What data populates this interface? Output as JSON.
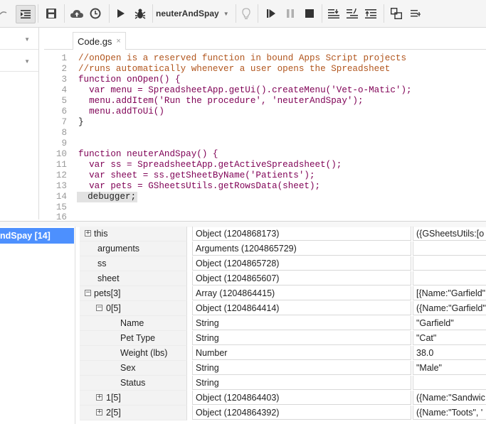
{
  "toolbar": {
    "function_name": "neuterAndSpay",
    "icons": [
      "redo-icon",
      "indent-icon",
      "save-icon",
      "publish-icon",
      "triggers-icon",
      "run-icon",
      "debug-icon",
      "hint-icon",
      "continue-icon",
      "pause-icon",
      "stop-icon",
      "step-into-icon",
      "step-over-icon",
      "step-out-icon",
      "toggle-panel-icon",
      "add-watch-icon"
    ]
  },
  "tab": {
    "label": "Code.gs",
    "close": "×"
  },
  "editor": {
    "lines": [
      {
        "num": "1",
        "text": "//onOpen is a reserved function in bound Apps Script projects"
      },
      {
        "num": "2",
        "text": "//runs automatically whenever a user opens the Spreadsheet"
      },
      {
        "num": "3",
        "text": "function onOpen() {"
      },
      {
        "num": "4",
        "text": "  var menu = SpreadsheetApp.getUi().createMenu('Vet-o-Matic');"
      },
      {
        "num": "5",
        "text": "  menu.addItem('Run the procedure', 'neuterAndSpay');"
      },
      {
        "num": "6",
        "text": "  menu.addToUi()"
      },
      {
        "num": "7",
        "text": "}"
      },
      {
        "num": "8",
        "text": ""
      },
      {
        "num": "9",
        "text": ""
      },
      {
        "num": "10",
        "text": "function neuterAndSpay() {"
      },
      {
        "num": "11",
        "text": "  var ss = SpreadsheetApp.getActiveSpreadsheet();"
      },
      {
        "num": "12",
        "text": "  var sheet = ss.getSheetByName('Patients');"
      },
      {
        "num": "13",
        "text": "  var pets = GSheetsUtils.getRowsData(sheet);"
      },
      {
        "num": "14",
        "text": "  debugger;"
      },
      {
        "num": "15",
        "text": ""
      },
      {
        "num": "16",
        "text": ""
      }
    ]
  },
  "callstack": {
    "selected": "ndSpay [14]"
  },
  "variables": [
    {
      "toggle": "+",
      "name": "this",
      "value": "Object (1204868173)",
      "preview": "({GSheetsUtils:[o"
    },
    {
      "toggle": "",
      "name": "arguments",
      "value": "Arguments (1204865729)",
      "preview": ""
    },
    {
      "toggle": "",
      "name": "ss",
      "value": "Object (1204865728)",
      "preview": ""
    },
    {
      "toggle": "",
      "name": "sheet",
      "value": "Object (1204865607)",
      "preview": ""
    },
    {
      "toggle": "−",
      "name": "pets[3]",
      "value": "Array (1204864415)",
      "preview": "[{Name:\"Garfield\""
    },
    {
      "toggle": "−",
      "name": "0[5]",
      "value": "Object (1204864414)",
      "preview": "({Name:\"Garfield\""
    },
    {
      "toggle": "",
      "name": "Name",
      "value": "String",
      "preview": "\"Garfield\""
    },
    {
      "toggle": "",
      "name": "Pet Type",
      "value": "String",
      "preview": "\"Cat\""
    },
    {
      "toggle": "",
      "name": "Weight (lbs)",
      "value": "Number",
      "preview": "38.0"
    },
    {
      "toggle": "",
      "name": "Sex",
      "value": "String",
      "preview": "\"Male\""
    },
    {
      "toggle": "",
      "name": "Status",
      "value": "String",
      "preview": ""
    },
    {
      "toggle": "+",
      "name": "1[5]",
      "value": "Object (1204864403)",
      "preview": "({Name:\"Sandwic"
    },
    {
      "toggle": "+",
      "name": "2[5]",
      "value": "Object (1204864392)",
      "preview": "({Name:\"Toots\", '"
    }
  ]
}
